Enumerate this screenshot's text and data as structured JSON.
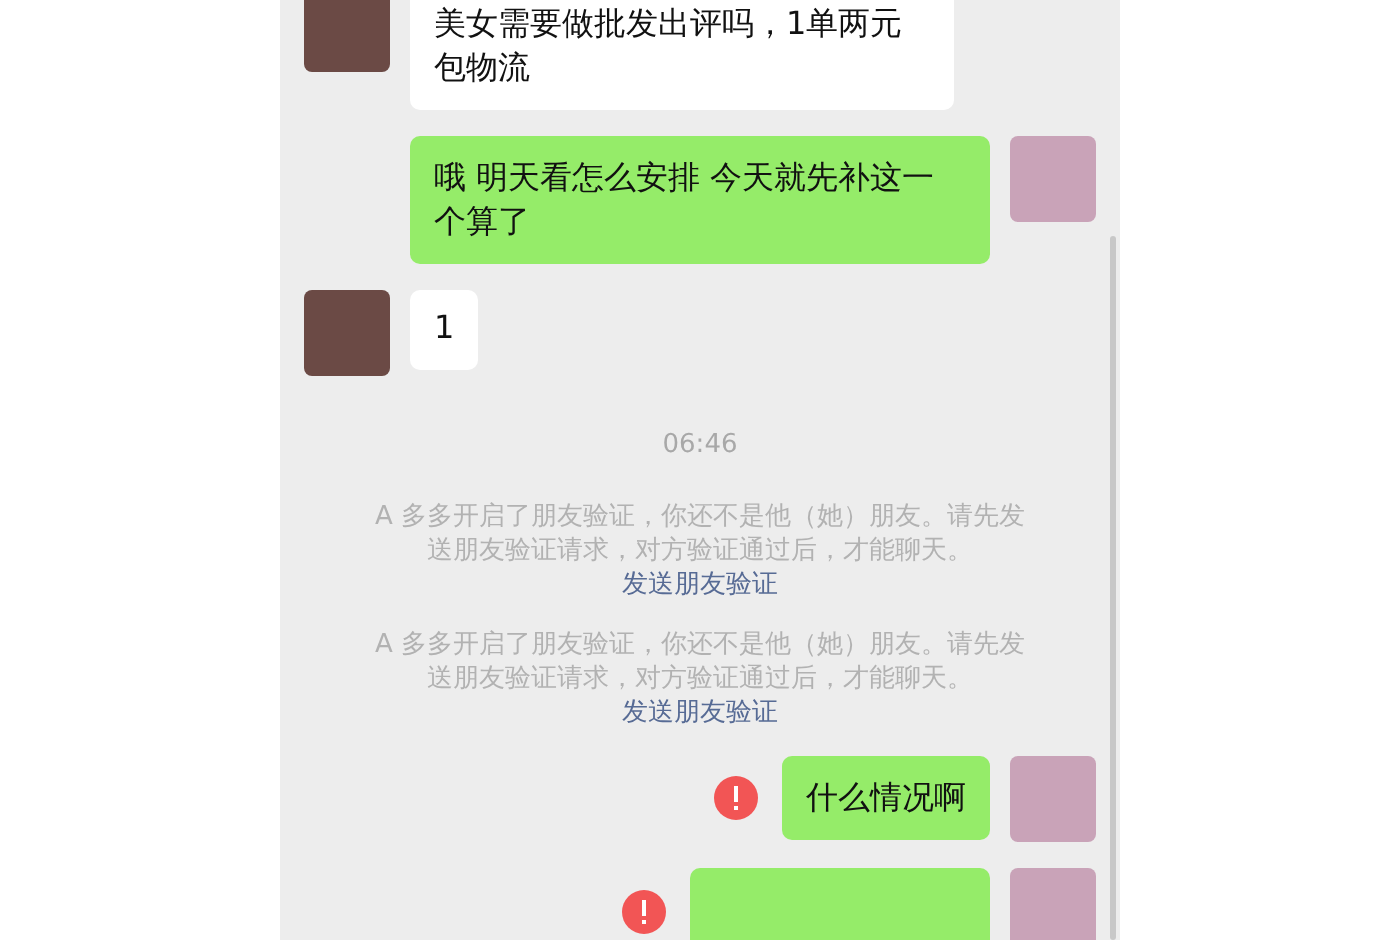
{
  "messages": [
    {
      "kind": "incoming",
      "text": "美女需要做批发出评吗，1单两元包物流"
    },
    {
      "kind": "outgoing",
      "text": "哦 明天看怎么安排 今天就先补这一个算了",
      "failed": false
    },
    {
      "kind": "incoming",
      "text": "1"
    },
    {
      "kind": "time",
      "text": "06:46"
    },
    {
      "kind": "notice",
      "text": "A 多多开启了朋友验证，你还不是他（她）朋友。请先发送朋友验证请求，对方验证通过后，才能聊天。",
      "link": "发送朋友验证"
    },
    {
      "kind": "notice",
      "text": "A 多多开启了朋友验证，你还不是他（她）朋友。请先发送朋友验证请求，对方验证通过后，才能聊天。",
      "link": "发送朋友验证"
    },
    {
      "kind": "outgoing",
      "text": "什么情况啊",
      "failed": true
    },
    {
      "kind": "outgoing",
      "failed": true
    }
  ]
}
